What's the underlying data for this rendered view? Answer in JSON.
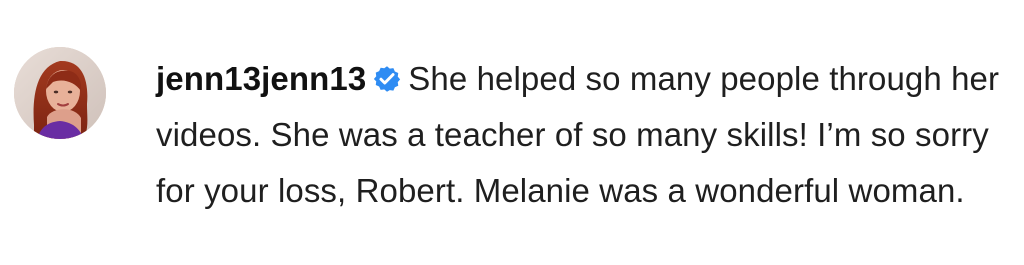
{
  "comment": {
    "username": "jenn13jenn13",
    "verified_icon": "verified-badge-icon",
    "verified_color": "#2f8cf3",
    "text": "She helped so many people through her videos. She was a teacher of so many skills! I’m so sorry for your loss, Robert. Melanie was a wonderful woman."
  }
}
